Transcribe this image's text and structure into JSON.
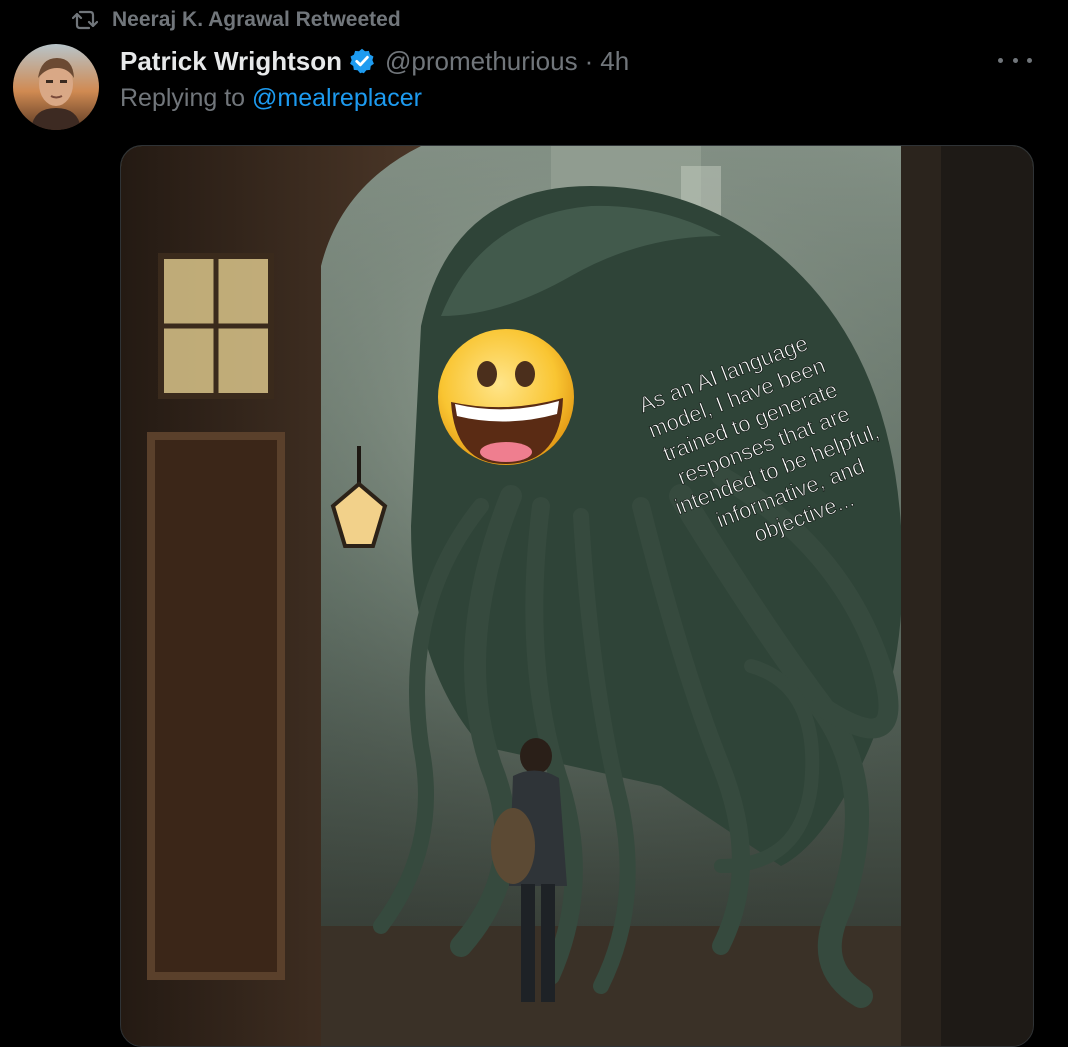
{
  "retweet": {
    "label": "Neeraj K. Agrawal Retweeted"
  },
  "tweet": {
    "author_name": "Patrick Wrightson",
    "handle": "@promethurious",
    "separator": "·",
    "time": "4h",
    "replying_prefix": "Replying to ",
    "replying_to": "@mealreplacer",
    "image_text_lines": [
      "As an AI language",
      "model, I have been",
      "trained to generate",
      "responses that are",
      "intended to be helpful,",
      "informative, and",
      "objective..."
    ]
  },
  "colors": {
    "background": "#000000",
    "text_primary": "#e7e9ea",
    "text_secondary": "#71767b",
    "accent": "#1d9bf0"
  },
  "icons": {
    "retweet": "retweet-icon",
    "verified": "verified-badge-icon",
    "more": "more-icon"
  }
}
